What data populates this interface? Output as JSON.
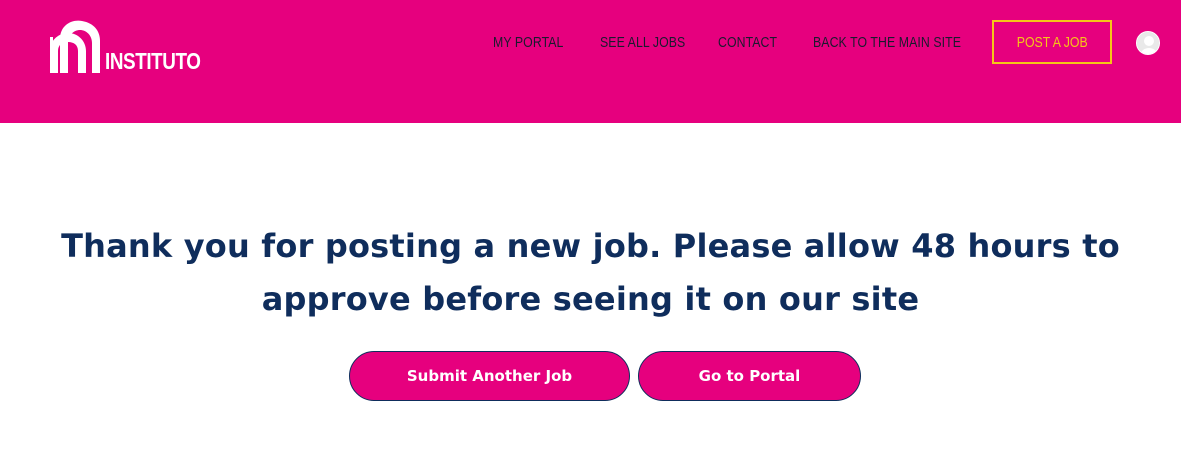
{
  "header": {
    "background_color": "#e6007e",
    "logo_text": "INSTITUTO",
    "nav": [
      {
        "label": "MY PORTAL"
      },
      {
        "label": "SEE ALL JOBS"
      },
      {
        "label": "CONTACT"
      },
      {
        "label": "BACK TO THE MAIN SITE"
      }
    ],
    "post_job_label": "POST A JOB",
    "post_job_color": "#f5c518",
    "avatar_icon": "user-avatar-icon"
  },
  "main": {
    "message_lines": [
      "Thank you for posting a new job. Please allow 48 hours to",
      "approve before seeing it on our site"
    ],
    "message_color": "#0f2d5c",
    "buttons": {
      "submit_another": "Submit Another Job",
      "go_to_portal": "Go to Portal"
    }
  }
}
